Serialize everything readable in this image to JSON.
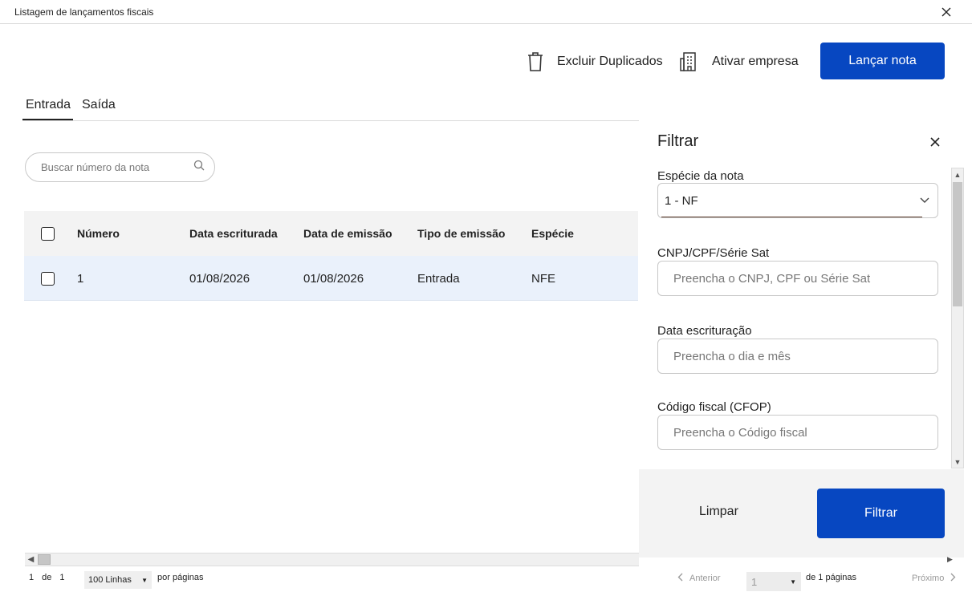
{
  "window": {
    "title": "Listagem de lançamentos fiscais"
  },
  "toolbar": {
    "delete_duplicates_label": "Excluir Duplicados",
    "activate_company_label": "Ativar empresa",
    "post_note_label": "Lançar nota"
  },
  "tabs": [
    {
      "label": "Entrada",
      "active": true
    },
    {
      "label": "Saída",
      "active": false
    }
  ],
  "search": {
    "placeholder": "Buscar número da nota"
  },
  "table": {
    "columns": [
      "Número",
      "Data escriturada",
      "Data de emissão",
      "Tipo de emissão",
      "Espécie"
    ],
    "rows": [
      {
        "numero": "1",
        "data_escriturada": "01/08/2026",
        "data_emissao": "01/08/2026",
        "tipo_emissao": "Entrada",
        "especie": "NFE"
      }
    ]
  },
  "filter": {
    "title": "Filtrar",
    "especie_label": "Espécie da nota",
    "especie_value": "1 - NF",
    "cnpj_label": "CNPJ/CPF/Série Sat",
    "cnpj_placeholder": "Preencha o CNPJ, CPF ou Série Sat",
    "data_label": "Data escrituração",
    "data_placeholder": "Preencha o dia e mês",
    "cfop_label": "Código fiscal (CFOP)",
    "cfop_placeholder": "Preencha o Código fiscal",
    "clear_label": "Limpar",
    "apply_label": "Filtrar"
  },
  "pagination": {
    "current_page": "1",
    "of_label": "de",
    "total_pages": "1",
    "rows_per_page": "100 Linhas",
    "per_page_label": "por páginas",
    "previous_label": "Anterior",
    "page_value": "1",
    "of_pages_label": "de 1 páginas",
    "next_label": "Próximo"
  },
  "colors": {
    "primary": "#0747c1",
    "row_selected_bg": "#eaf1fb",
    "header_bg": "#f3f3f3"
  }
}
